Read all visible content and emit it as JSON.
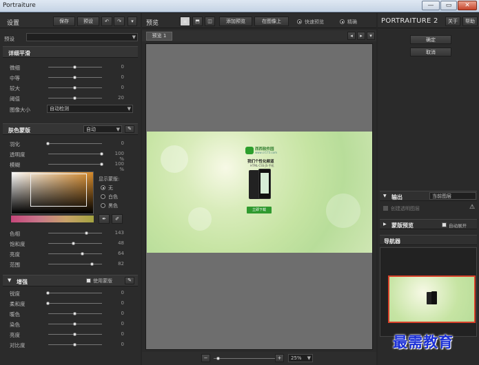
{
  "window": {
    "title": "Portraiture",
    "min": "—",
    "max": "▭",
    "close": "✕"
  },
  "left": {
    "header": {
      "title": "设置",
      "save": "保存",
      "preset": "预设",
      "undo": "↶",
      "redo": "↷",
      "menu": "▾"
    },
    "preset_label": "预设",
    "detail": {
      "title": "详细平滑",
      "sliders": [
        {
          "label": "微细",
          "value": "0"
        },
        {
          "label": "中等",
          "value": "0"
        },
        {
          "label": "较大",
          "value": "0"
        },
        {
          "label": "阈值",
          "value": "20"
        }
      ],
      "size_label": "图像大小",
      "size_value": "自动检测"
    },
    "skin": {
      "title": "肤色蒙版",
      "mode": "自动",
      "sliders": [
        {
          "label": "羽化",
          "value": "0"
        },
        {
          "label": "透明度",
          "value": "100 %"
        },
        {
          "label": "模糊",
          "value": "100 %"
        }
      ],
      "show_mask": "显示蒙版:",
      "radios": [
        "无",
        "白色",
        "黑色"
      ],
      "bottom": [
        {
          "label": "色相",
          "value": "143"
        },
        {
          "label": "饱和度",
          "value": "48"
        },
        {
          "label": "亮度",
          "value": "64"
        },
        {
          "label": "范围",
          "value": "82"
        }
      ]
    },
    "enhance": {
      "title": "增强",
      "use_mask": "使用蒙版",
      "sliders": [
        {
          "label": "锐度",
          "value": "0"
        },
        {
          "label": "柔和度",
          "value": "0"
        },
        {
          "label": "暖色",
          "value": "0"
        },
        {
          "label": "染色",
          "value": "0"
        },
        {
          "label": "亮度",
          "value": "0"
        },
        {
          "label": "对比度",
          "value": "0"
        }
      ]
    }
  },
  "center": {
    "header": {
      "title": "预览",
      "add_preview": "添加预览",
      "overlay": "在图像上",
      "radio1": "快速预览",
      "radio2": "精确"
    },
    "tab": "预览 1",
    "zoom": "25%",
    "ad": {
      "brand": "西西软件园",
      "sub": "www.cr173.com",
      "headline": "我们个性化频道",
      "line": "HTML·CSS·JS·手机",
      "button": "立即下载"
    }
  },
  "right": {
    "header": {
      "title": "PORTRAITURE 2",
      "about": "关于",
      "help": "帮助"
    },
    "ok": "确定",
    "cancel": "取消",
    "output": {
      "title": "输出",
      "value": "当前图层",
      "option": "创建透明图层"
    },
    "mask_preview": {
      "title": "蒙版预览",
      "auto": "自动展开"
    },
    "navigator": "导航器"
  },
  "watermark": "最需教育",
  "colors": {
    "accent": "#d9412a",
    "watermark": "#1a2fd6"
  }
}
